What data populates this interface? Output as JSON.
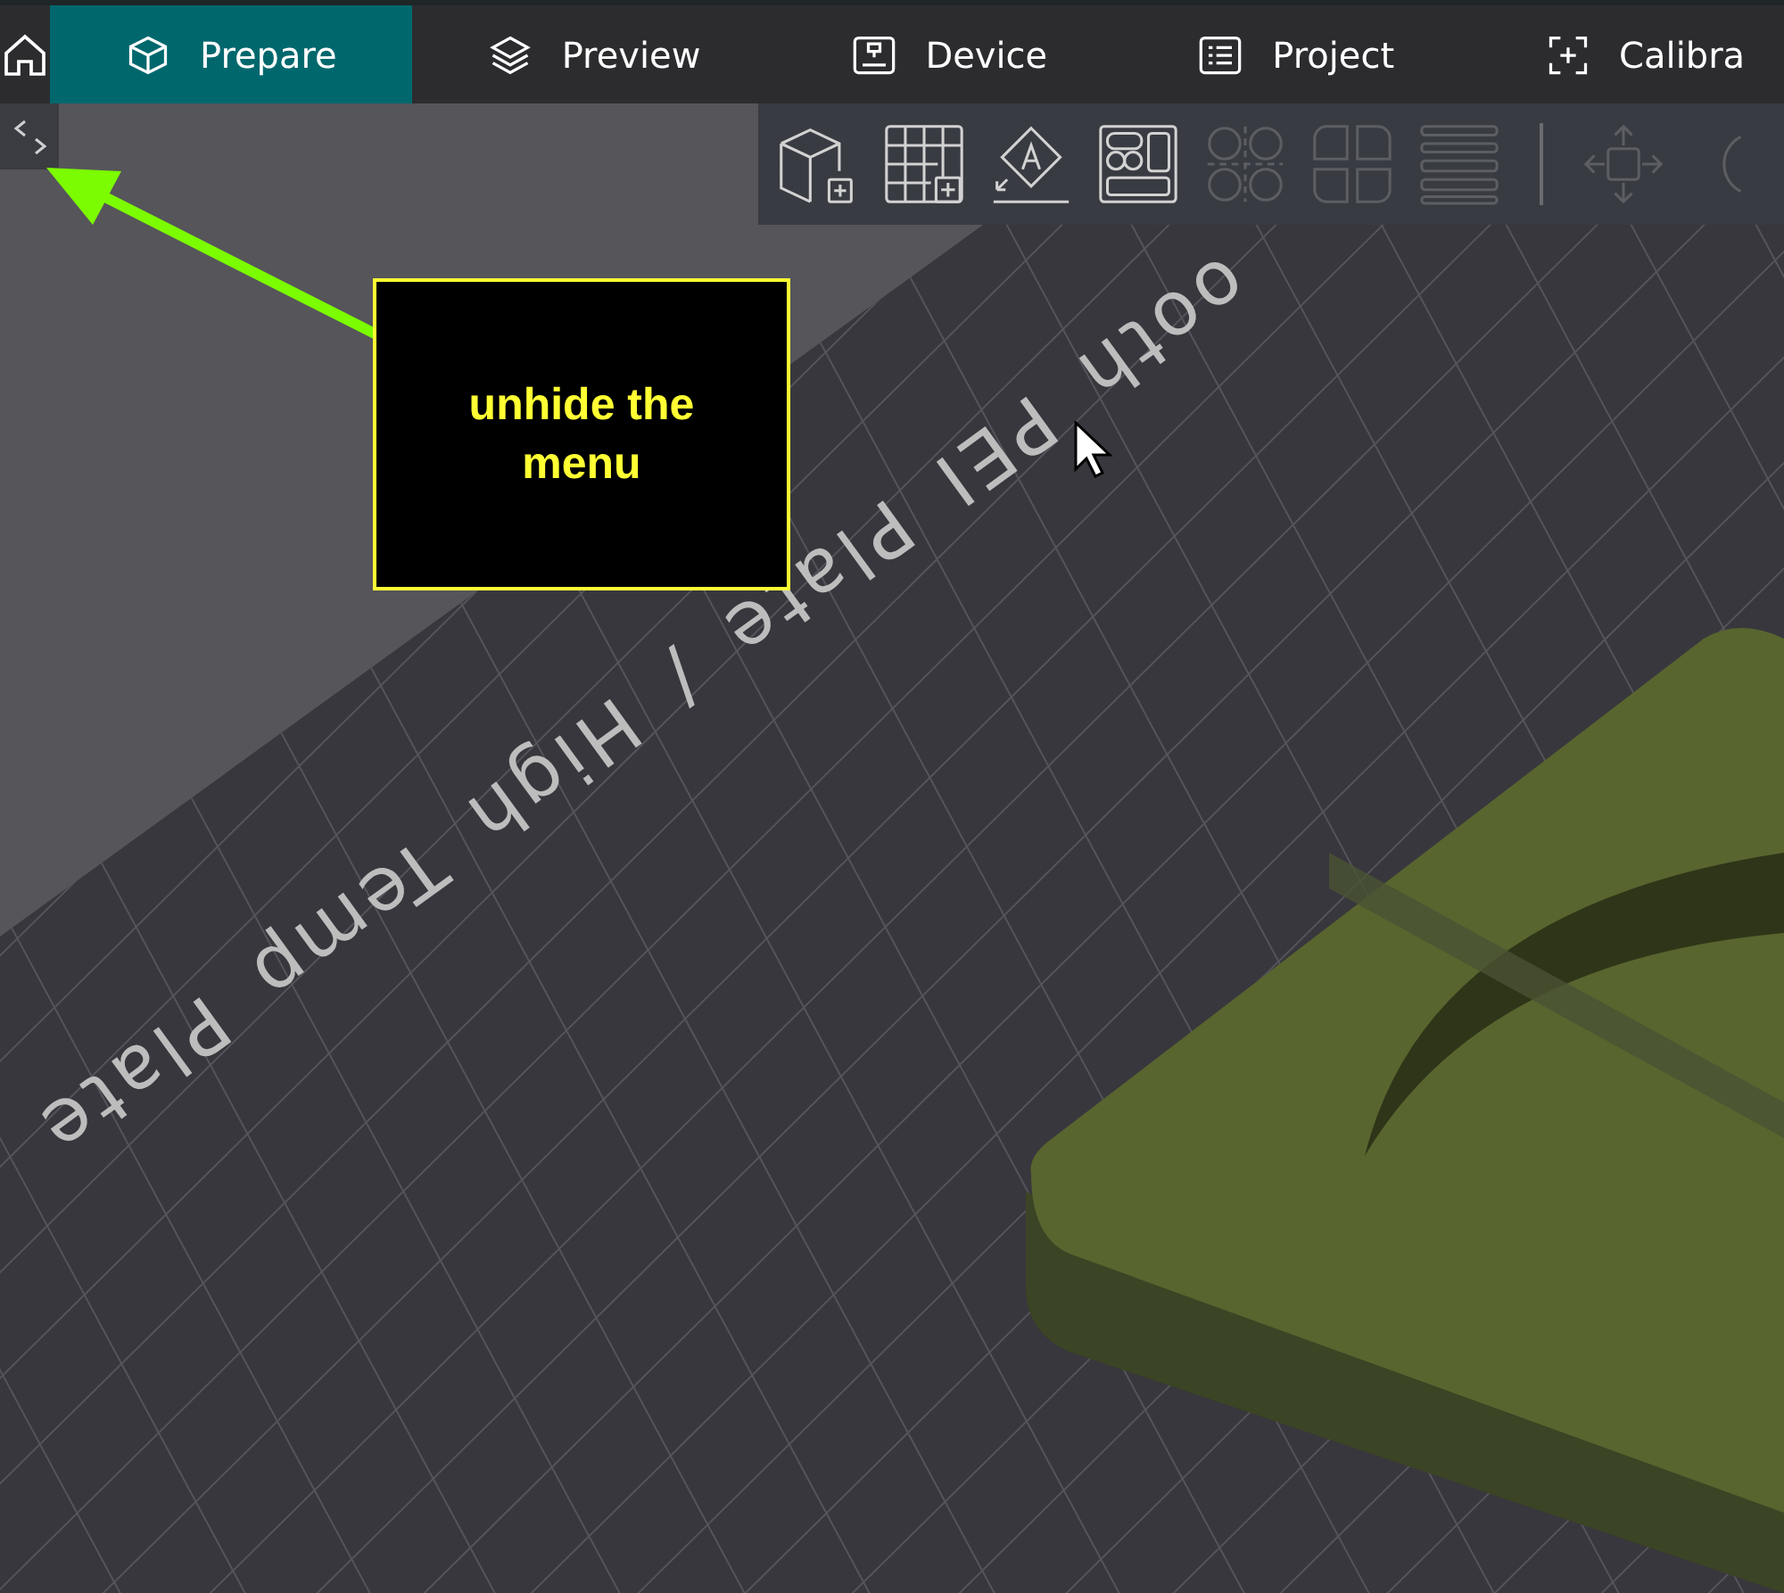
{
  "tabs": [
    {
      "label": "Prepare",
      "selected": true
    },
    {
      "label": "Preview",
      "selected": false
    },
    {
      "label": "Device",
      "selected": false
    },
    {
      "label": "Project",
      "selected": false
    },
    {
      "label": "Calibra",
      "selected": false
    }
  ],
  "toolbar": {
    "tools": [
      {
        "disabled": false
      },
      {
        "disabled": false
      },
      {
        "disabled": false
      },
      {
        "disabled": false
      },
      {
        "disabled": true
      },
      {
        "disabled": true
      },
      {
        "disabled": true
      },
      {
        "disabled": true
      },
      {
        "disabled": true
      }
    ]
  },
  "plate_label": "ooth PEI Plate / High Temp Plate",
  "annotation": {
    "text": "unhide the menu"
  }
}
